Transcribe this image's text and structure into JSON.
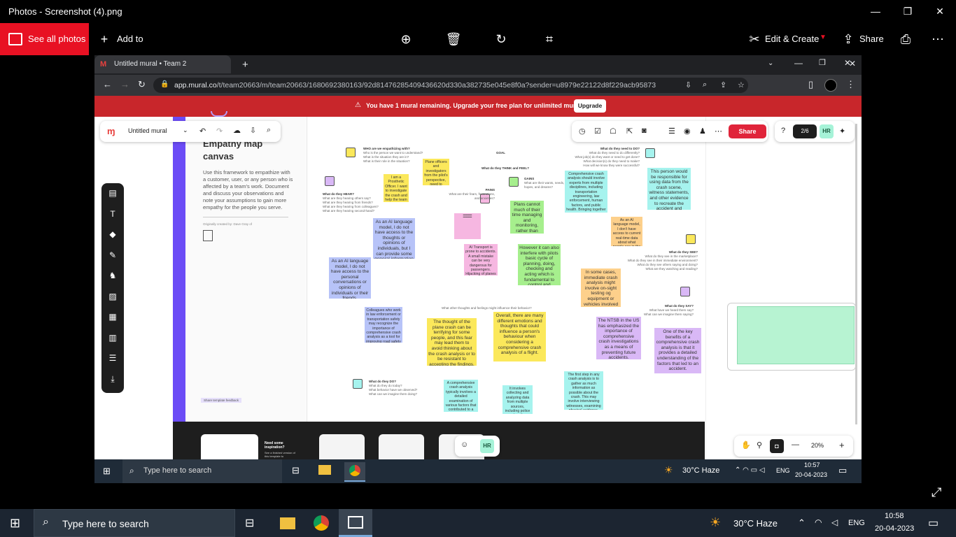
{
  "photos": {
    "title": "Photos - Screenshot (4).png",
    "see_all": "See all photos",
    "add_to": "Add to",
    "edit_create": "Edit & Create",
    "share": "Share",
    "window_controls": [
      "—",
      "❐",
      "✕"
    ]
  },
  "browser": {
    "tab_title": "Untitled mural • Team 2",
    "url_host": "app.mural.co",
    "url_path": "/t/team20663/m/team20663/1680692380163/92d81476285409436620d330a382735e045e8f0a?sender=u8979e22122d8f229acb95873"
  },
  "banner": {
    "message": "You have 1 mural remaining. Upgrade your free plan for unlimited murals.",
    "upgrade": "Upgrade"
  },
  "mural": {
    "name": "Untitled mural",
    "share": "Share",
    "participants": "2/6",
    "avatar": "HR",
    "zoom": "20%",
    "canvas_title": "Empathy map canvas",
    "canvas_desc": "Use this framework to empathize with a customer, user, or any person who is affected by a team's work. Document and discuss your observations and note your assumptions to gain more empathy for the people you serve.",
    "created_by": "Originally created by: Dave Gray of",
    "feedback": "Share template feedback",
    "goal": "GOAL",
    "think_feel": "What do they THINK and FEEL?",
    "pains": "PAINS",
    "pains_sub": "What are their fears, frustrations, and anxieties?",
    "gains": "GAINS",
    "gains_sub": "What are their wants, needs, hopes, and dreams?",
    "who": "WHO are we empathizing with?",
    "who_sub": [
      "Who is the person we want to understand?",
      "What is the situation they are in?",
      "What is their role in the situation?"
    ],
    "need_do": "What do they need to DO?",
    "need_do_sub": [
      "What do they need to do differently?",
      "What job(s) do they want or need to get done?",
      "What decision(s) do they need to make?",
      "How will we know they were successful?"
    ],
    "hear": "What do they HEAR?",
    "hear_sub": [
      "What are they hearing others say?",
      "What are they hearing from friends?",
      "What are they hearing from colleagues?",
      "What are they hearing second-hand?"
    ],
    "see": "What do they SEE?",
    "see_sub": [
      "What do they see in the marketplace?",
      "What do they see in their immediate environment?",
      "What do they see others saying and doing?",
      "What are they watching and reading?"
    ],
    "say": "What do they SAY?",
    "say_sub": [
      "What have we heard them say?",
      "What can we imagine them saying?"
    ],
    "do": "What do they DO?",
    "do_sub": [
      "What do they do today?",
      "What behavior have we observed?",
      "What can we imagine them doing?"
    ],
    "other": "What other thoughts and feelings might influence their behavior?",
    "inspiration": "Need some inspiration?",
    "inspiration_sub": "See a finished version of this template to"
  },
  "stickies": [
    "As an AI language model, I do not have access to the thoughts or opinions of individuals, but I can provide some general information on what people might be saying about comprehensive crash analysis.",
    "As an AI language model, I do not have access to the personal conversations or opinions of individuals or their friends.",
    "Colleagues who work in law enforcement or transportation safety may recognize the importance of comprehensive crash analysis as a tool for improving road safety and reducing the number of traffic fatalities and injuries.",
    "Plans cannot much of their time managing and monitoring, rather than actively flying their aircraft.",
    "However it can also interfere with pilots basic cycle of planning, doing, checking and acting which is fundamental to control and learning.",
    "AI Transport is prone to accidents. A small mistake can be very dangerous for passengers. Hijacking of planes is easily possible.",
    "Comprehensive crash analysis should involve experts from multiple disciplines, including transportation engineering, law enforcement, human factors, and public health. Bringing together different perspectives and expertise can lead to more accurate and insightful analysis.",
    "This person would be responsible for using data from the crash scene, witness statements, and other evidence to recreate the accident and determine how it happened.",
    "As an AI language model, I don't have access to current real-time data about what people see in the market place.",
    "In some cases, immediate crash analysis might involve on-sight testing og equipment or vehicles involved in the crash.",
    "The thought of the plane crash can be terrifying for some people, and this fear may lead them to avoid thinking about the crash analysis or to be resistant to accepting the findings.",
    "Overall, there are many different emotions and thoughts that could influence a person's behaviour when considering a comprehensive crash analysis of a flight.",
    "The NTSB in the US has emphasized the importance of comprehensive crash investigations as a means of preventing future accidents.",
    "One of the key benefits of a comprehensive crash analysis is that it provides a detailed understanding of the factors that led to an accident.",
    "A comprehensive crash analysis typically involves a detailed examination of various factors that contributed to a crash, such as driver behavior, road conditions, vehicle performance, and environmental factors.",
    "It involves collecting and analyzing data from multiple sources, including police reports, witness statements, and physical evidence from the crash site.",
    "The first step in any crash analysis is to gather as much information as possible about the crash. This may involve interviewing witnesses, examining physical evidence, reviewing police reports, and analyzing data from any available sources, such as surveillance footage or social media accounts.",
    "I am a Prosthetic Officer. I want to investigate the crash and help the team in determining the cause of the accident.",
    "Plane officers and investigators from the pilot's perspective, need to understand the causes of accidents to help prevent similar accidents from occurring in the future."
  ],
  "inner_taskbar": {
    "search": "Type here to search",
    "weather": "30°C  Haze",
    "lang": "ENG",
    "time": "10:57",
    "date": "20-04-2023"
  },
  "taskbar": {
    "search": "Type here to search",
    "weather": "30°C  Haze",
    "lang": "ENG",
    "time": "10:58",
    "date": "20-04-2023"
  }
}
